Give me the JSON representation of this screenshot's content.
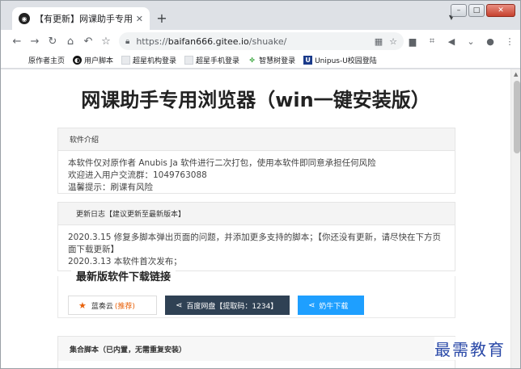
{
  "browser": {
    "tab_title": "【有更新】网课助手专用浏览器",
    "url_prefix": "https://",
    "url_host": "baifan666.gitee.io",
    "url_path": "/shuake/"
  },
  "bookmarks": [
    {
      "label": "原作者主页",
      "icon": "none"
    },
    {
      "label": "用户脚本",
      "icon": "black-circle-icon"
    },
    {
      "label": "超星机构登录",
      "icon": "page-icon"
    },
    {
      "label": "超星手机登录",
      "icon": "page-icon"
    },
    {
      "label": "智慧树登录",
      "icon": "leaf-icon"
    },
    {
      "label": "Unipus-U校园登陆",
      "icon": "u-logo-icon"
    }
  ],
  "page": {
    "title": "网课助手专用浏览器（win一键安装版）",
    "intro": {
      "header": "软件介绍",
      "lines": [
        "本软件仅对原作者 Anubis Ja 软件进行二次打包，使用本软件即同意承担任何风险",
        "欢迎进入用户交流群：1049763088",
        "温馨提示：刷课有风险"
      ]
    },
    "changelog": {
      "header": "更新日志【建议更新至最新版本】",
      "lines": [
        "2020.3.15 修复多脚本弹出页面的问题，并添加更多支持的脚本；【你还没有更新，请尽快在下方页面下载更新】",
        "2020.3.13 本软件首次发布；"
      ]
    },
    "download": {
      "title": "最新版软件下载链接",
      "lanzou_label": "蓝奏云",
      "lanzou_tag": "(推荐)",
      "baidu_label": "百度网盘【提取码：1234】",
      "niu_label": "奶牛下载"
    },
    "scripts": {
      "header": "集合脚本（已内置，无需重复安装）"
    }
  },
  "watermark": "最需教育",
  "colors": {
    "baidu_button": "#2f4154",
    "niu_button": "#1e9fff",
    "accent_orange": "#e8610a",
    "watermark": "#2b4aa8"
  }
}
